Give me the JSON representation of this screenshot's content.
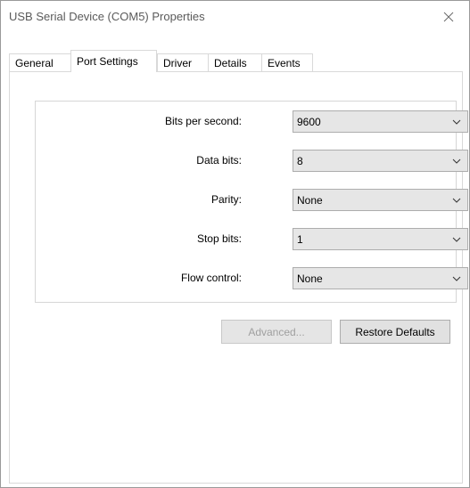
{
  "window": {
    "title": "USB Serial Device (COM5) Properties",
    "close_icon": "close-icon"
  },
  "tabs": [
    {
      "label": "General",
      "active": false
    },
    {
      "label": "Port Settings",
      "active": true
    },
    {
      "label": "Driver",
      "active": false
    },
    {
      "label": "Details",
      "active": false
    },
    {
      "label": "Events",
      "active": false
    }
  ],
  "settings": [
    {
      "label": "Bits per second:",
      "value": "9600"
    },
    {
      "label": "Data bits:",
      "value": "8"
    },
    {
      "label": "Parity:",
      "value": "None"
    },
    {
      "label": "Stop bits:",
      "value": "1"
    },
    {
      "label": "Flow control:",
      "value": "None"
    }
  ],
  "buttons": {
    "advanced": {
      "label": "Advanced...",
      "enabled": false
    },
    "restore": {
      "label": "Restore Defaults",
      "enabled": true
    }
  }
}
